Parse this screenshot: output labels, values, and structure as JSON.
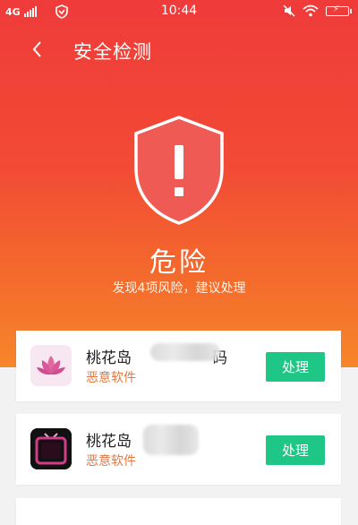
{
  "status_bar": {
    "network": "4G",
    "time": "10:44"
  },
  "header": {
    "title": "安全检测"
  },
  "result": {
    "level": "危险",
    "summary": "发现4项风险，建议处理"
  },
  "risks": [
    {
      "name_prefix": "桃花岛",
      "name_suffix": "码",
      "type": "恶意软件",
      "action": "处理",
      "icon": "lotus-app-icon"
    },
    {
      "name_prefix": "桃花岛",
      "name_suffix": "",
      "type": "恶意软件",
      "action": "处理",
      "icon": "tv-app-icon"
    }
  ],
  "colors": {
    "danger_top": "#ef3b3a",
    "danger_bottom": "#f7862a",
    "action_button": "#1ec785",
    "risk_tag": "#e07a45"
  }
}
